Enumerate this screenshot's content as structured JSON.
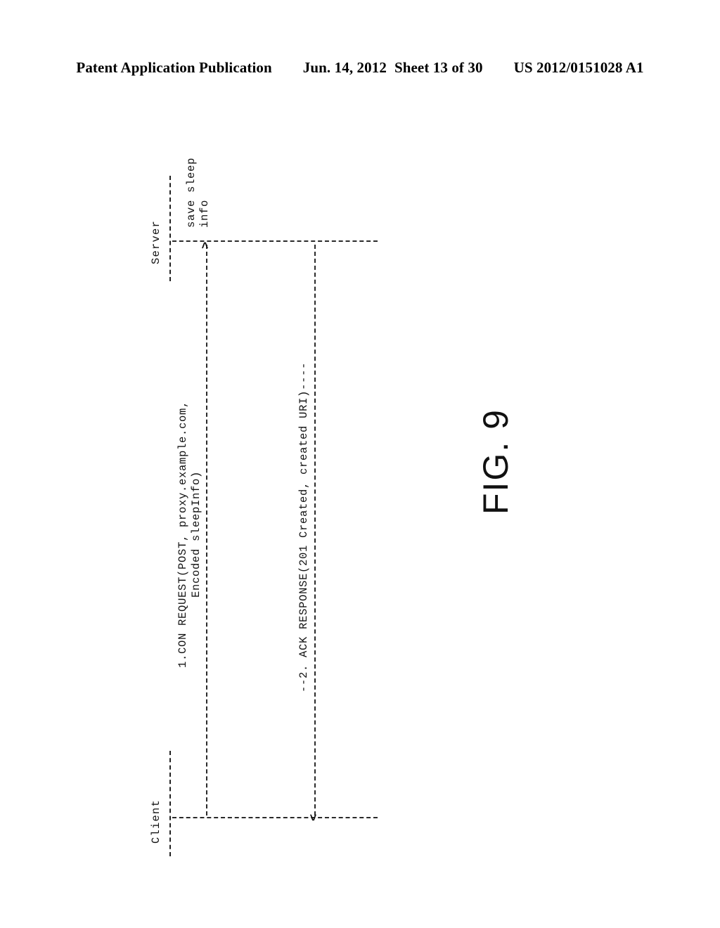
{
  "header": {
    "publication": "Patent Application Publication",
    "date": "Jun. 14, 2012",
    "sheet": "Sheet 13 of 30",
    "patent_number": "US 2012/0151028 A1"
  },
  "figure": {
    "caption": "FIG. 9"
  },
  "diagram": {
    "type": "sequence-diagram",
    "actors": [
      {
        "id": "client",
        "label": "Client"
      },
      {
        "id": "server",
        "label": "Server"
      }
    ],
    "messages": [
      {
        "index": "1",
        "from": "client",
        "to": "server",
        "arrow_glyph": ">",
        "line1": "1.CON REQUEST(POST, proxy.example.com,",
        "line2": "Encoded sleepInfo)"
      },
      {
        "index": "2",
        "from": "server",
        "to": "client",
        "arrow_glyph": "<",
        "line1": "--2. ACK RESPONSE(201 Created, created URI)----",
        "line2": ""
      }
    ],
    "notes": [
      {
        "id": "save-sleep-info",
        "actor": "server",
        "line1": "save sleep",
        "line2": "info"
      }
    ]
  }
}
